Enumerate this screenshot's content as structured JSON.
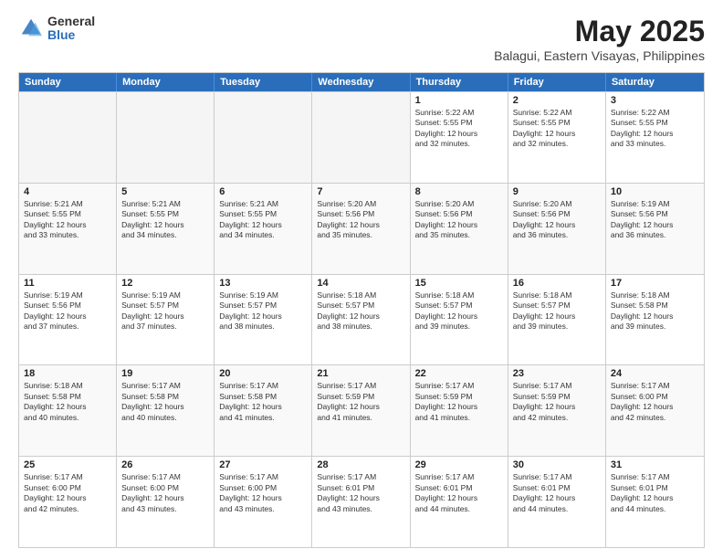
{
  "logo": {
    "general": "General",
    "blue": "Blue"
  },
  "title": "May 2025",
  "subtitle": "Balagui, Eastern Visayas, Philippines",
  "header": {
    "days": [
      "Sunday",
      "Monday",
      "Tuesday",
      "Wednesday",
      "Thursday",
      "Friday",
      "Saturday"
    ]
  },
  "rows": [
    {
      "cells": [
        {
          "day": "",
          "content": ""
        },
        {
          "day": "",
          "content": ""
        },
        {
          "day": "",
          "content": ""
        },
        {
          "day": "",
          "content": ""
        },
        {
          "day": "1",
          "content": "Sunrise: 5:22 AM\nSunset: 5:55 PM\nDaylight: 12 hours\nand 32 minutes."
        },
        {
          "day": "2",
          "content": "Sunrise: 5:22 AM\nSunset: 5:55 PM\nDaylight: 12 hours\nand 32 minutes."
        },
        {
          "day": "3",
          "content": "Sunrise: 5:22 AM\nSunset: 5:55 PM\nDaylight: 12 hours\nand 33 minutes."
        }
      ]
    },
    {
      "cells": [
        {
          "day": "4",
          "content": "Sunrise: 5:21 AM\nSunset: 5:55 PM\nDaylight: 12 hours\nand 33 minutes."
        },
        {
          "day": "5",
          "content": "Sunrise: 5:21 AM\nSunset: 5:55 PM\nDaylight: 12 hours\nand 34 minutes."
        },
        {
          "day": "6",
          "content": "Sunrise: 5:21 AM\nSunset: 5:55 PM\nDaylight: 12 hours\nand 34 minutes."
        },
        {
          "day": "7",
          "content": "Sunrise: 5:20 AM\nSunset: 5:56 PM\nDaylight: 12 hours\nand 35 minutes."
        },
        {
          "day": "8",
          "content": "Sunrise: 5:20 AM\nSunset: 5:56 PM\nDaylight: 12 hours\nand 35 minutes."
        },
        {
          "day": "9",
          "content": "Sunrise: 5:20 AM\nSunset: 5:56 PM\nDaylight: 12 hours\nand 36 minutes."
        },
        {
          "day": "10",
          "content": "Sunrise: 5:19 AM\nSunset: 5:56 PM\nDaylight: 12 hours\nand 36 minutes."
        }
      ]
    },
    {
      "cells": [
        {
          "day": "11",
          "content": "Sunrise: 5:19 AM\nSunset: 5:56 PM\nDaylight: 12 hours\nand 37 minutes."
        },
        {
          "day": "12",
          "content": "Sunrise: 5:19 AM\nSunset: 5:57 PM\nDaylight: 12 hours\nand 37 minutes."
        },
        {
          "day": "13",
          "content": "Sunrise: 5:19 AM\nSunset: 5:57 PM\nDaylight: 12 hours\nand 38 minutes."
        },
        {
          "day": "14",
          "content": "Sunrise: 5:18 AM\nSunset: 5:57 PM\nDaylight: 12 hours\nand 38 minutes."
        },
        {
          "day": "15",
          "content": "Sunrise: 5:18 AM\nSunset: 5:57 PM\nDaylight: 12 hours\nand 39 minutes."
        },
        {
          "day": "16",
          "content": "Sunrise: 5:18 AM\nSunset: 5:57 PM\nDaylight: 12 hours\nand 39 minutes."
        },
        {
          "day": "17",
          "content": "Sunrise: 5:18 AM\nSunset: 5:58 PM\nDaylight: 12 hours\nand 39 minutes."
        }
      ]
    },
    {
      "cells": [
        {
          "day": "18",
          "content": "Sunrise: 5:18 AM\nSunset: 5:58 PM\nDaylight: 12 hours\nand 40 minutes."
        },
        {
          "day": "19",
          "content": "Sunrise: 5:17 AM\nSunset: 5:58 PM\nDaylight: 12 hours\nand 40 minutes."
        },
        {
          "day": "20",
          "content": "Sunrise: 5:17 AM\nSunset: 5:58 PM\nDaylight: 12 hours\nand 41 minutes."
        },
        {
          "day": "21",
          "content": "Sunrise: 5:17 AM\nSunset: 5:59 PM\nDaylight: 12 hours\nand 41 minutes."
        },
        {
          "day": "22",
          "content": "Sunrise: 5:17 AM\nSunset: 5:59 PM\nDaylight: 12 hours\nand 41 minutes."
        },
        {
          "day": "23",
          "content": "Sunrise: 5:17 AM\nSunset: 5:59 PM\nDaylight: 12 hours\nand 42 minutes."
        },
        {
          "day": "24",
          "content": "Sunrise: 5:17 AM\nSunset: 6:00 PM\nDaylight: 12 hours\nand 42 minutes."
        }
      ]
    },
    {
      "cells": [
        {
          "day": "25",
          "content": "Sunrise: 5:17 AM\nSunset: 6:00 PM\nDaylight: 12 hours\nand 42 minutes."
        },
        {
          "day": "26",
          "content": "Sunrise: 5:17 AM\nSunset: 6:00 PM\nDaylight: 12 hours\nand 43 minutes."
        },
        {
          "day": "27",
          "content": "Sunrise: 5:17 AM\nSunset: 6:00 PM\nDaylight: 12 hours\nand 43 minutes."
        },
        {
          "day": "28",
          "content": "Sunrise: 5:17 AM\nSunset: 6:01 PM\nDaylight: 12 hours\nand 43 minutes."
        },
        {
          "day": "29",
          "content": "Sunrise: 5:17 AM\nSunset: 6:01 PM\nDaylight: 12 hours\nand 44 minutes."
        },
        {
          "day": "30",
          "content": "Sunrise: 5:17 AM\nSunset: 6:01 PM\nDaylight: 12 hours\nand 44 minutes."
        },
        {
          "day": "31",
          "content": "Sunrise: 5:17 AM\nSunset: 6:01 PM\nDaylight: 12 hours\nand 44 minutes."
        }
      ]
    }
  ]
}
